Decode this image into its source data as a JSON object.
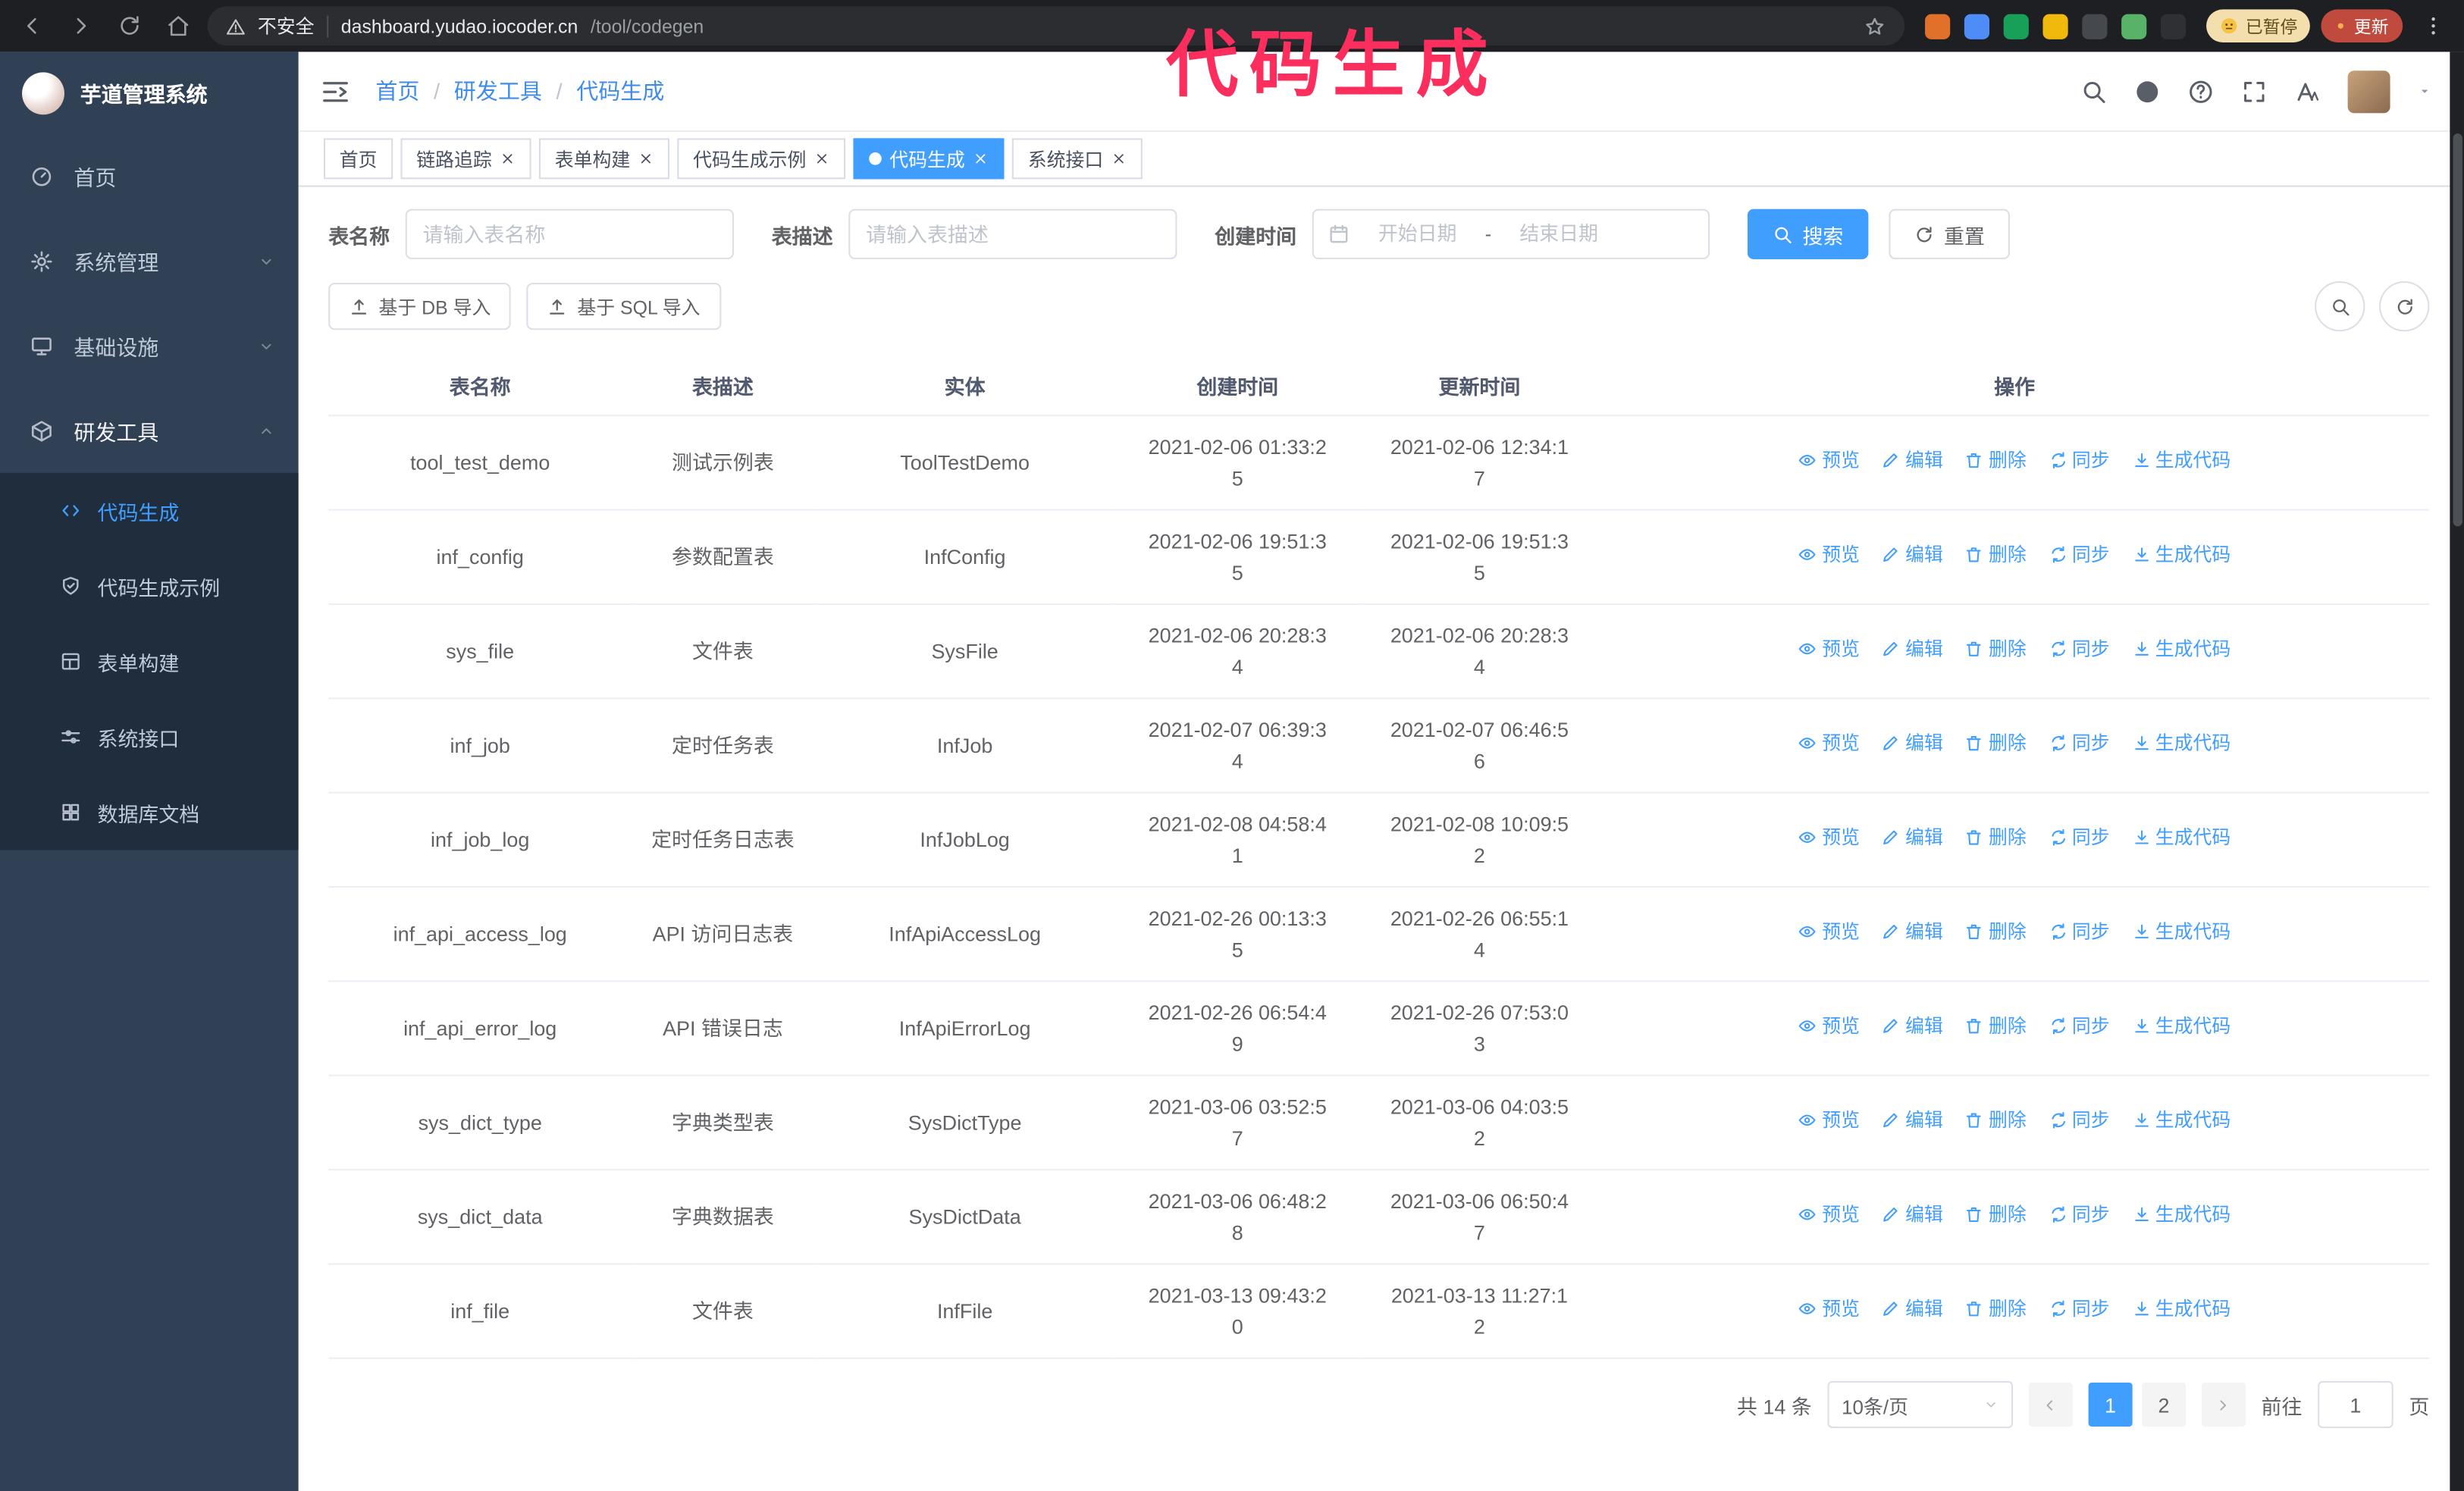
{
  "theme": {
    "accent": "#409eff",
    "sidebar": "#304156",
    "submenu": "#1f2d3d",
    "annotation": "#fb2e5e"
  },
  "annotation": {
    "text": "代码生成"
  },
  "browser": {
    "warning_label": "不安全",
    "url_host": "dashboard.yudao.iocoder.cn",
    "url_path": "/tool/codegen",
    "paused_label": "已暂停",
    "update_label": "更新",
    "extension_colors": [
      "#e0702a",
      "#4e8cf7",
      "#18a058",
      "#f2b90d",
      "#45494d",
      "#58b368",
      "#2f3033"
    ]
  },
  "sidebar": {
    "logo_title": "芋道管理系统",
    "menu": [
      {
        "key": "home",
        "label": "首页",
        "icon": "dashboard"
      },
      {
        "key": "system",
        "label": "系统管理",
        "icon": "gear",
        "chevron": "down"
      },
      {
        "key": "infra",
        "label": "基础设施",
        "icon": "infra",
        "chevron": "down"
      },
      {
        "key": "devtools",
        "label": "研发工具",
        "icon": "tools",
        "chevron": "up",
        "expanded": true,
        "children": [
          {
            "key": "codegen",
            "label": "代码生成",
            "icon": "code",
            "active": true
          },
          {
            "key": "codegen-example",
            "label": "代码生成示例",
            "icon": "shield"
          },
          {
            "key": "form-builder",
            "label": "表单构建",
            "icon": "formgrid"
          },
          {
            "key": "system-api",
            "label": "系统接口",
            "icon": "sliders"
          },
          {
            "key": "db-doc",
            "label": "数据库文档",
            "icon": "grid"
          }
        ]
      }
    ]
  },
  "header": {
    "breadcrumb": [
      "首页",
      "研发工具",
      "代码生成"
    ],
    "separator": "/"
  },
  "tabs": [
    {
      "key": "home",
      "label": "首页",
      "closable": false
    },
    {
      "key": "tracing",
      "label": "链路追踪",
      "closable": true
    },
    {
      "key": "form-builder",
      "label": "表单构建",
      "closable": true
    },
    {
      "key": "codegen-example",
      "label": "代码生成示例",
      "closable": true
    },
    {
      "key": "codegen",
      "label": "代码生成",
      "closable": true,
      "active": true
    },
    {
      "key": "system-api",
      "label": "系统接口",
      "closable": true
    }
  ],
  "filters": {
    "table_name_label": "表名称",
    "table_name_placeholder": "请输入表名称",
    "table_desc_label": "表描述",
    "table_desc_placeholder": "请输入表描述",
    "create_time_label": "创建时间",
    "date_start_placeholder": "开始日期",
    "date_separator": "-",
    "date_end_placeholder": "结束日期",
    "search_label": "搜索",
    "reset_label": "重置"
  },
  "toolbar": {
    "import_db_label": "基于 DB 导入",
    "import_sql_label": "基于 SQL 导入"
  },
  "table": {
    "columns": [
      "表名称",
      "表描述",
      "实体",
      "创建时间",
      "更新时间",
      "操作"
    ],
    "row_actions": [
      "预览",
      "编辑",
      "删除",
      "同步",
      "生成代码"
    ],
    "rows": [
      {
        "name": "tool_test_demo",
        "desc": "测试示例表",
        "entity": "ToolTestDemo",
        "created": "2021-02-06 01:33:25",
        "updated": "2021-02-06 12:34:17"
      },
      {
        "name": "inf_config",
        "desc": "参数配置表",
        "entity": "InfConfig",
        "created": "2021-02-06 19:51:35",
        "updated": "2021-02-06 19:51:35"
      },
      {
        "name": "sys_file",
        "desc": "文件表",
        "entity": "SysFile",
        "created": "2021-02-06 20:28:34",
        "updated": "2021-02-06 20:28:34"
      },
      {
        "name": "inf_job",
        "desc": "定时任务表",
        "entity": "InfJob",
        "created": "2021-02-07 06:39:34",
        "updated": "2021-02-07 06:46:56"
      },
      {
        "name": "inf_job_log",
        "desc": "定时任务日志表",
        "entity": "InfJobLog",
        "created": "2021-02-08 04:58:41",
        "updated": "2021-02-08 10:09:52"
      },
      {
        "name": "inf_api_access_log",
        "desc": "API 访问日志表",
        "entity": "InfApiAccessLog",
        "created": "2021-02-26 00:13:35",
        "updated": "2021-02-26 06:55:14"
      },
      {
        "name": "inf_api_error_log",
        "desc": "API 错误日志",
        "entity": "InfApiErrorLog",
        "created": "2021-02-26 06:54:49",
        "updated": "2021-02-26 07:53:03"
      },
      {
        "name": "sys_dict_type",
        "desc": "字典类型表",
        "entity": "SysDictType",
        "created": "2021-03-06 03:52:57",
        "updated": "2021-03-06 04:03:52"
      },
      {
        "name": "sys_dict_data",
        "desc": "字典数据表",
        "entity": "SysDictData",
        "created": "2021-03-06 06:48:28",
        "updated": "2021-03-06 06:50:47"
      },
      {
        "name": "inf_file",
        "desc": "文件表",
        "entity": "InfFile",
        "created": "2021-03-13 09:43:20",
        "updated": "2021-03-13 11:27:12"
      }
    ]
  },
  "pagination": {
    "total_label": "共 14 条",
    "page_size_label": "10条/页",
    "pages": [
      "1",
      "2"
    ],
    "active_page": "1",
    "goto_label": "前往",
    "goto_value": "1",
    "goto_suffix": "页"
  }
}
